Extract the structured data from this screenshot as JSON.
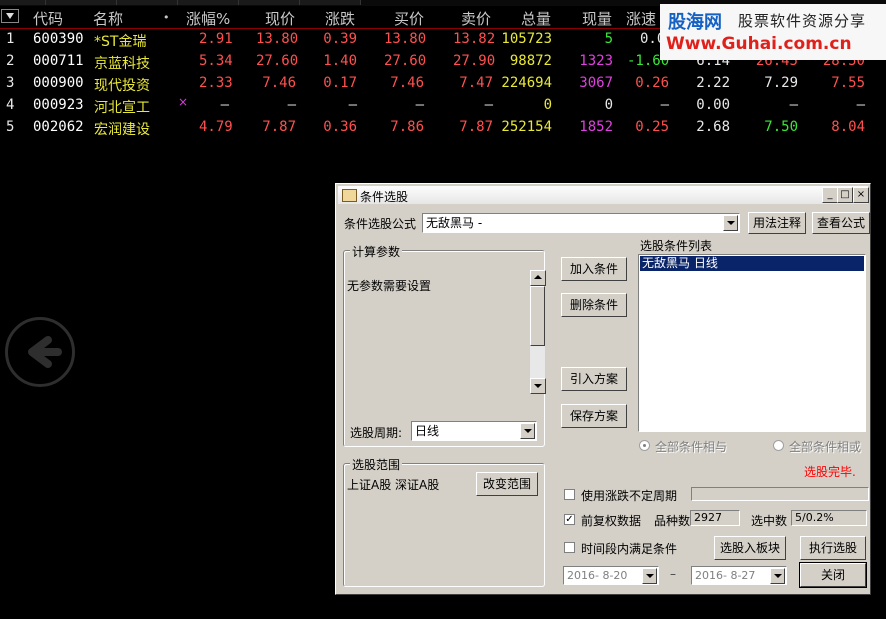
{
  "columns": [
    "代码",
    "名称",
    "•",
    "涨幅%",
    "现价",
    "涨跌",
    "买价",
    "卖价",
    "总量",
    "现量",
    "涨速"
  ],
  "rows": [
    {
      "idx": "1",
      "code": "600390",
      "name": "*ST金瑞",
      "mark": "",
      "chg_pct": "2.91",
      "price": "13.80",
      "chg": "0.39",
      "bid": "13.80",
      "ask": "13.82",
      "vol": "105723",
      "cur": "5",
      "speed": "0.0",
      "e1": "",
      "e2": "",
      "e3": ""
    },
    {
      "idx": "2",
      "code": "000711",
      "name": "京蓝科技",
      "mark": "",
      "chg_pct": "5.34",
      "price": "27.60",
      "chg": "1.40",
      "bid": "27.60",
      "ask": "27.90",
      "vol": "98872",
      "cur": "1323",
      "speed": "-1.60",
      "e1": "6.14",
      "e2": "26.45",
      "e3": "28.50"
    },
    {
      "idx": "3",
      "code": "000900",
      "name": "现代投资",
      "mark": "",
      "chg_pct": "2.33",
      "price": "7.46",
      "chg": "0.17",
      "bid": "7.46",
      "ask": "7.47",
      "vol": "224694",
      "cur": "3067",
      "speed": "0.26",
      "e1": "2.22",
      "e2": "7.29",
      "e3": "7.55"
    },
    {
      "idx": "4",
      "code": "000923",
      "name": "河北宣工",
      "mark": "×",
      "chg_pct": "–",
      "price": "–",
      "chg": "–",
      "bid": "–",
      "ask": "–",
      "vol": "0",
      "cur": "0",
      "speed": "–",
      "e1": "0.00",
      "e2": "–",
      "e3": "–"
    },
    {
      "idx": "5",
      "code": "002062",
      "name": "宏润建设",
      "mark": "",
      "chg_pct": "4.79",
      "price": "7.87",
      "chg": "0.36",
      "bid": "7.86",
      "ask": "7.87",
      "vol": "252154",
      "cur": "1852",
      "speed": "0.25",
      "e1": "2.68",
      "e2": "7.50",
      "e3": "8.04"
    }
  ],
  "watermark": {
    "brand": "股海网",
    "slogan": "股票软件资源分享",
    "url": "Www.Guhai.com.cn"
  },
  "dialog": {
    "title": "条件选股",
    "formula_label": "条件选股公式",
    "formula_value": "无敌黑马      -",
    "usage_btn": "用法注释",
    "view_btn": "查看公式",
    "params_group": "计算参数",
    "params_text": "无参数需要设置",
    "period_label": "选股周期:",
    "period_value": "日线",
    "add_btn": "加入条件",
    "del_btn": "删除条件",
    "import_btn": "引入方案",
    "save_btn": "保存方案",
    "list_label": "选股条件列表",
    "conditions": [
      "无敌黑马   日线"
    ],
    "radio_and": "全部条件相与",
    "radio_or": "全部条件相或",
    "status": "选股完毕.",
    "range_group": "选股范围",
    "range_text": "上证A股 深证A股",
    "change_range_btn": "改变范围",
    "cb_uncertain": "使用涨跌不定周期",
    "cb_adjusted": "前复权数据",
    "cb_adjusted_mark": "✓",
    "count_label": "品种数",
    "count_value": "2927",
    "selected_label": "选中数",
    "selected_value": "5/0.2%",
    "cb_timerange": "时间段内满足条件",
    "to_block_btn": "选股入板块",
    "run_btn": "执行选股",
    "date_from": "2016- 8-20",
    "date_sep": "–",
    "date_to": "2016- 8-27",
    "close_btn": "关闭"
  },
  "colors": {
    "up": "#ff5050",
    "white": "#e8e8e8",
    "yellow": "#e8e838",
    "magenta": "#e040e0",
    "green": "#38e838",
    "code": "#ffffff",
    "status": "#ff0000",
    "select_bg": "#0a246a"
  }
}
